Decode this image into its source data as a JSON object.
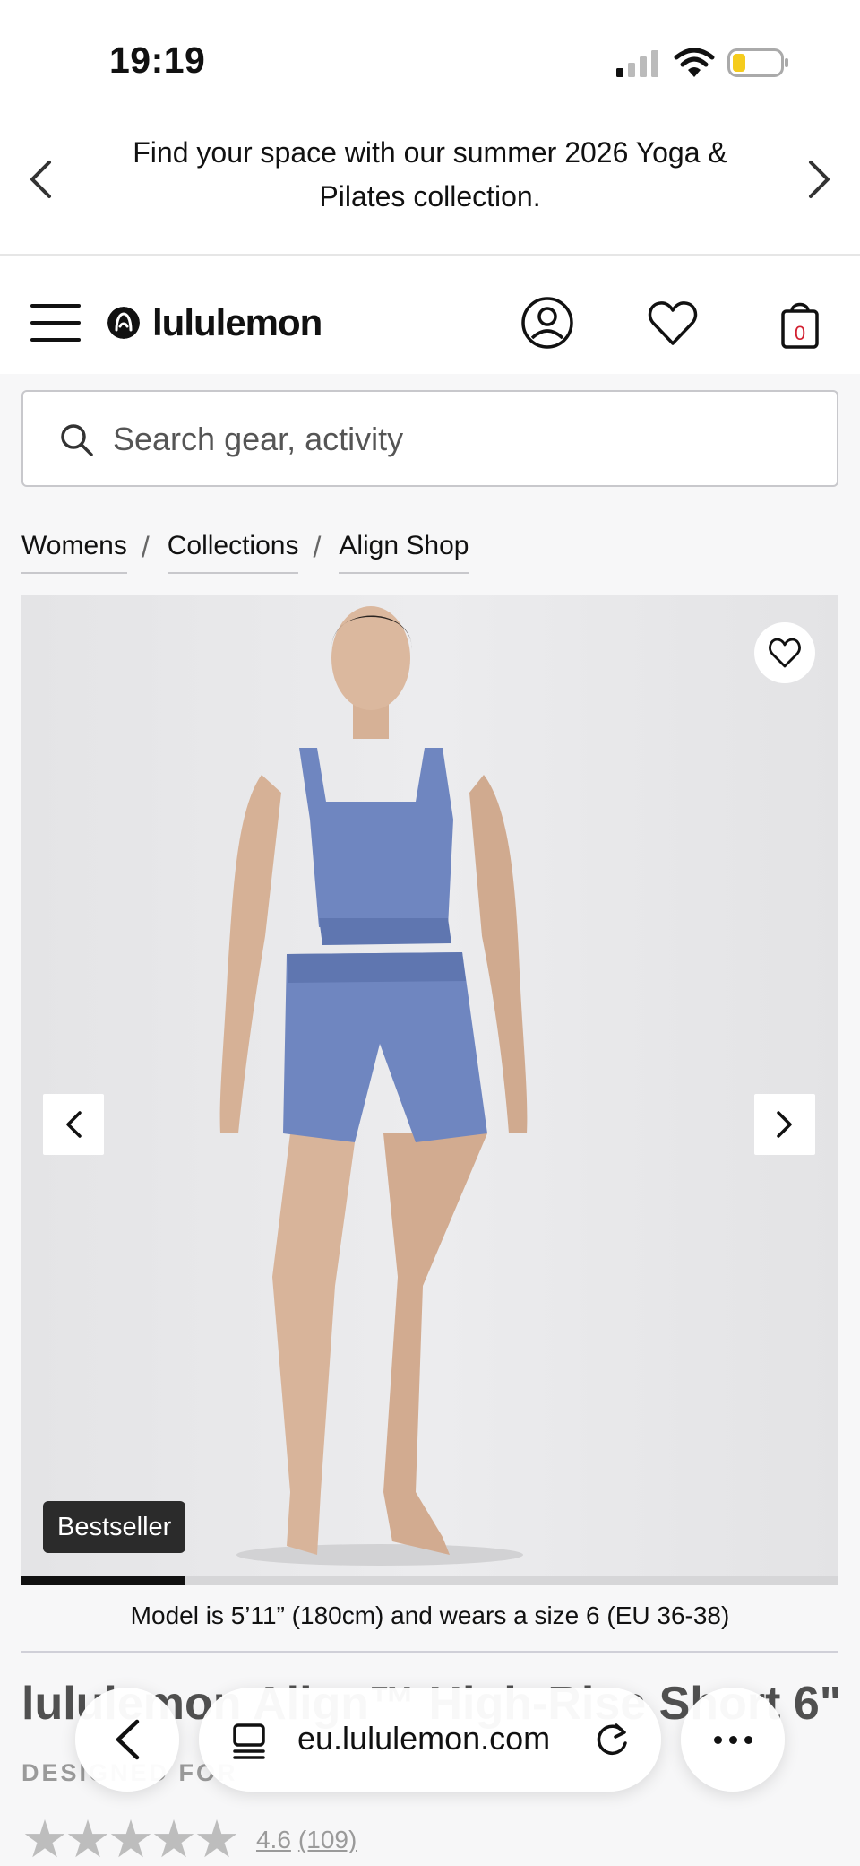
{
  "status_bar": {
    "time": "19:19"
  },
  "promo": {
    "text": "Find your space with our summer 2026 Yoga & Pilates collection."
  },
  "header": {
    "brand": "lululemon",
    "cart_count": "0"
  },
  "search": {
    "placeholder": "Search gear, activity"
  },
  "breadcrumb": [
    "Womens",
    "Collections",
    "Align Shop"
  ],
  "product": {
    "badge": "Bestseller",
    "image_progress": 0.2,
    "model_note": "Model is 5’11” (180cm) and wears a size 6 (EU 36-38)",
    "title": "lululemon Align™ High-Rise Short 6\"",
    "designed_for": "DESIGNED FOR",
    "rating": "4.6",
    "review_count": "(109)"
  },
  "browser": {
    "url": "eu.lululemon.com"
  },
  "colors": {
    "accent_badge": "#2b2b2b",
    "page_grey": "#f7f7f8",
    "cart_red": "#d22030",
    "product_blue": "#6f86c0"
  }
}
